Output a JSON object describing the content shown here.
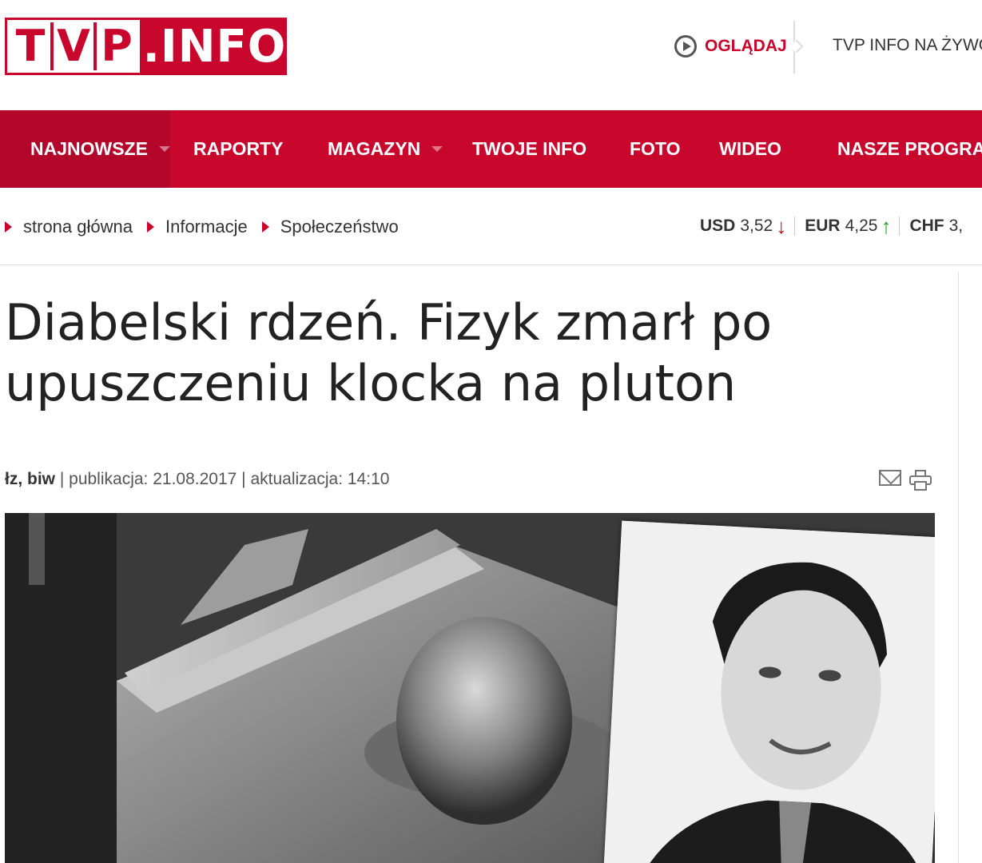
{
  "header": {
    "logo_left": [
      "T",
      "V",
      "P"
    ],
    "logo_right": ".INFO",
    "watch_label": "OGLĄDAJ",
    "live_label": "TVP INFO NA ŻYWO"
  },
  "nav": {
    "items": [
      {
        "label": "NAJNOWSZE",
        "has_dropdown": true,
        "active": true
      },
      {
        "label": "RAPORTY",
        "has_dropdown": false
      },
      {
        "label": "MAGAZYN",
        "has_dropdown": true
      },
      {
        "label": "TWOJE INFO",
        "has_dropdown": false
      },
      {
        "label": "FOTO",
        "has_dropdown": false
      },
      {
        "label": "WIDEO",
        "has_dropdown": false
      },
      {
        "label": "NASZE PROGRAMY",
        "has_dropdown": false
      }
    ]
  },
  "breadcrumb": [
    "strona główna",
    "Informacje",
    "Społeczeństwo"
  ],
  "rates": [
    {
      "currency": "USD",
      "value": "3,52",
      "trend": "down"
    },
    {
      "currency": "EUR",
      "value": "4,25",
      "trend": "up"
    },
    {
      "currency": "CHF",
      "value": "3,",
      "trend": ""
    }
  ],
  "article": {
    "title": "Diabelski rdzeń. Fizyk zmarł po upuszczeniu klocka na pluton",
    "authors": "łz, biw",
    "published_label": "publikacja:",
    "published_date": "21.08.2017",
    "updated_label": "aktualizacja:",
    "updated_time": "14:10"
  },
  "icons": {
    "play": "play-circle-icon",
    "mail": "envelope-icon",
    "print": "printer-icon",
    "down": "arrow-down-icon",
    "up": "arrow-up-icon"
  },
  "colors": {
    "brand": "#c9062c",
    "down": "#d60b0b",
    "up": "#19a21b"
  }
}
